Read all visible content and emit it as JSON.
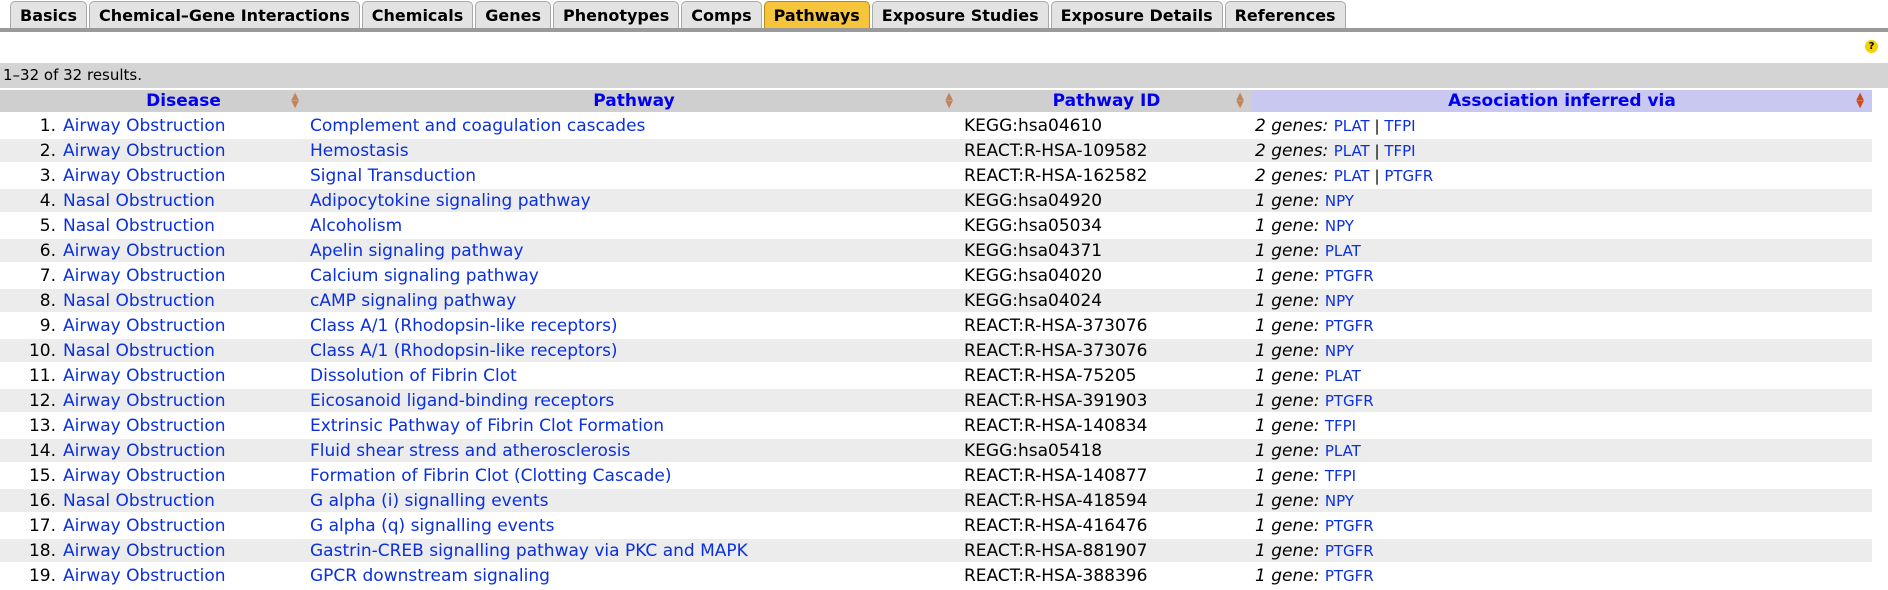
{
  "tabs": [
    {
      "label": "Basics",
      "active": false
    },
    {
      "label": "Chemical–Gene Interactions",
      "active": false
    },
    {
      "label": "Chemicals",
      "active": false
    },
    {
      "label": "Genes",
      "active": false
    },
    {
      "label": "Phenotypes",
      "active": false
    },
    {
      "label": "Comps",
      "active": false
    },
    {
      "label": "Pathways",
      "active": true
    },
    {
      "label": "Exposure Studies",
      "active": false
    },
    {
      "label": "Exposure Details",
      "active": false
    },
    {
      "label": "References",
      "active": false
    }
  ],
  "help_label": "?",
  "results_text": "1–32 of 32 results.",
  "columns": {
    "disease": "Disease",
    "pathway": "Pathway",
    "pathway_id": "Pathway ID",
    "via": "Association inferred via"
  },
  "rows": [
    {
      "num": "1.",
      "disease": "Airway Obstruction",
      "pathway": "Complement and coagulation cascades",
      "id": "KEGG:hsa04610",
      "count": "2 genes:",
      "genes": [
        "PLAT",
        "TFPI"
      ]
    },
    {
      "num": "2.",
      "disease": "Airway Obstruction",
      "pathway": "Hemostasis",
      "id": "REACT:R-HSA-109582",
      "count": "2 genes:",
      "genes": [
        "PLAT",
        "TFPI"
      ]
    },
    {
      "num": "3.",
      "disease": "Airway Obstruction",
      "pathway": "Signal Transduction",
      "id": "REACT:R-HSA-162582",
      "count": "2 genes:",
      "genes": [
        "PLAT",
        "PTGFR"
      ]
    },
    {
      "num": "4.",
      "disease": "Nasal Obstruction",
      "pathway": "Adipocytokine signaling pathway",
      "id": "KEGG:hsa04920",
      "count": "1 gene:",
      "genes": [
        "NPY"
      ]
    },
    {
      "num": "5.",
      "disease": "Nasal Obstruction",
      "pathway": "Alcoholism",
      "id": "KEGG:hsa05034",
      "count": "1 gene:",
      "genes": [
        "NPY"
      ]
    },
    {
      "num": "6.",
      "disease": "Airway Obstruction",
      "pathway": "Apelin signaling pathway",
      "id": "KEGG:hsa04371",
      "count": "1 gene:",
      "genes": [
        "PLAT"
      ]
    },
    {
      "num": "7.",
      "disease": "Airway Obstruction",
      "pathway": "Calcium signaling pathway",
      "id": "KEGG:hsa04020",
      "count": "1 gene:",
      "genes": [
        "PTGFR"
      ]
    },
    {
      "num": "8.",
      "disease": "Nasal Obstruction",
      "pathway": "cAMP signaling pathway",
      "id": "KEGG:hsa04024",
      "count": "1 gene:",
      "genes": [
        "NPY"
      ]
    },
    {
      "num": "9.",
      "disease": "Airway Obstruction",
      "pathway": "Class A/1 (Rhodopsin-like receptors)",
      "id": "REACT:R-HSA-373076",
      "count": "1 gene:",
      "genes": [
        "PTGFR"
      ]
    },
    {
      "num": "10.",
      "disease": "Nasal Obstruction",
      "pathway": "Class A/1 (Rhodopsin-like receptors)",
      "id": "REACT:R-HSA-373076",
      "count": "1 gene:",
      "genes": [
        "NPY"
      ]
    },
    {
      "num": "11.",
      "disease": "Airway Obstruction",
      "pathway": "Dissolution of Fibrin Clot",
      "id": "REACT:R-HSA-75205",
      "count": "1 gene:",
      "genes": [
        "PLAT"
      ]
    },
    {
      "num": "12.",
      "disease": "Airway Obstruction",
      "pathway": "Eicosanoid ligand-binding receptors",
      "id": "REACT:R-HSA-391903",
      "count": "1 gene:",
      "genes": [
        "PTGFR"
      ]
    },
    {
      "num": "13.",
      "disease": "Airway Obstruction",
      "pathway": "Extrinsic Pathway of Fibrin Clot Formation",
      "id": "REACT:R-HSA-140834",
      "count": "1 gene:",
      "genes": [
        "TFPI"
      ]
    },
    {
      "num": "14.",
      "disease": "Airway Obstruction",
      "pathway": "Fluid shear stress and atherosclerosis",
      "id": "KEGG:hsa05418",
      "count": "1 gene:",
      "genes": [
        "PLAT"
      ]
    },
    {
      "num": "15.",
      "disease": "Airway Obstruction",
      "pathway": "Formation of Fibrin Clot (Clotting Cascade)",
      "id": "REACT:R-HSA-140877",
      "count": "1 gene:",
      "genes": [
        "TFPI"
      ]
    },
    {
      "num": "16.",
      "disease": "Nasal Obstruction",
      "pathway": "G alpha (i) signalling events",
      "id": "REACT:R-HSA-418594",
      "count": "1 gene:",
      "genes": [
        "NPY"
      ]
    },
    {
      "num": "17.",
      "disease": "Airway Obstruction",
      "pathway": "G alpha (q) signalling events",
      "id": "REACT:R-HSA-416476",
      "count": "1 gene:",
      "genes": [
        "PTGFR"
      ]
    },
    {
      "num": "18.",
      "disease": "Airway Obstruction",
      "pathway": "Gastrin-CREB signalling pathway via PKC and MAPK",
      "id": "REACT:R-HSA-881907",
      "count": "1 gene:",
      "genes": [
        "PTGFR"
      ]
    },
    {
      "num": "19.",
      "disease": "Airway Obstruction",
      "pathway": "GPCR downstream signaling",
      "id": "REACT:R-HSA-388396",
      "count": "1 gene:",
      "genes": [
        "PTGFR"
      ]
    }
  ]
}
